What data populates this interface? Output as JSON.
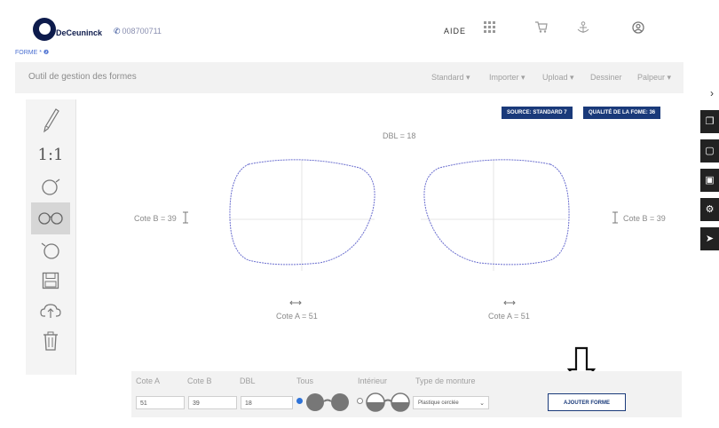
{
  "header": {
    "logo_text": "DeCeuninck",
    "phone": "008700711",
    "aide": "AIDE",
    "icons": [
      "grid-icon",
      "cart-icon",
      "anchor-icon",
      "user-icon"
    ]
  },
  "forme_label": "FORME * ❷",
  "titlebar": {
    "title": "Outil de gestion des formes",
    "menu": [
      "Standard ▾",
      "Importer ▾",
      "Upload ▾",
      "Dessiner",
      "Palpeur ▾"
    ]
  },
  "right_panel": {
    "chevron": "›",
    "buttons": [
      "copy-icon",
      "file-icon",
      "save-icon",
      "settings-icon",
      "send-icon"
    ]
  },
  "toolbar": {
    "one_to_one": "1:1",
    "tools": [
      "pen-icon",
      "scale-icon",
      "single-lens-icon",
      "glasses-icon",
      "rotate-lens-icon",
      "save-icon",
      "upload-icon",
      "trash-icon"
    ]
  },
  "badges": {
    "source": "SOURCE: STANDARD 7",
    "quality": "QUALITÉ DE LA FOME: 36"
  },
  "preview": {
    "dbl": "DBL = 18",
    "cote_b_left": "Cote B = 39",
    "cote_b_right": "Cote B = 39",
    "cote_a_left": "Cote A = 51",
    "cote_a_right": "Cote A = 51"
  },
  "form": {
    "labels": {
      "cote_a": "Cote A",
      "cote_b": "Cote B",
      "dbl": "DBL",
      "tous": "Tous",
      "interieur": "Intérieur",
      "type_monture": "Type de monture"
    },
    "values": {
      "cote_a": "51",
      "cote_b": "39",
      "dbl": "18"
    },
    "type_monture_selected": "Plastique cerclée",
    "add_button": "AJOUTER FORME"
  }
}
